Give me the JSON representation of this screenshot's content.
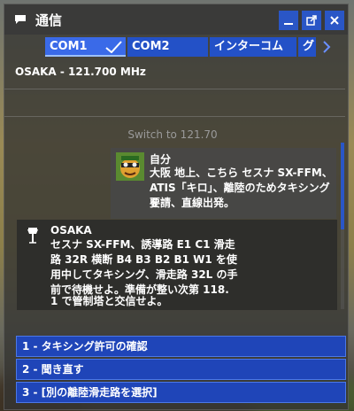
{
  "window": {
    "title": "通信"
  },
  "tabs": [
    {
      "label": "COM1",
      "active": true
    },
    {
      "label": "COM2",
      "active": false
    },
    {
      "label": "インターコム",
      "active": false
    },
    {
      "label": "グ",
      "active": false
    }
  ],
  "frequency": {
    "label": "OSAKA - 121.700 MHz"
  },
  "switch_hint": "Switch to 121.70",
  "messages": {
    "self": {
      "sender": "自分",
      "lines": [
        "大阪 地上、こちら セスナ SX-FFM、",
        "ATIS「キロ」、離陸のためタキシングを",
        "要請、直線出発。"
      ]
    },
    "atc": {
      "sender": "OSAKA",
      "lines": [
        "セスナ SX-FFM、誘導路 E1 C1 滑走",
        "路 32R 横断 B4 B3 B2 B1 W1 を使",
        "用中してタキシング、滑走路 32L の手",
        "前で待機せよ。準備が整い次第 118.",
        "1 で管制塔と交信せよ。"
      ]
    }
  },
  "options": [
    {
      "label": "1 - タキシング許可の確認"
    },
    {
      "label": "2 - 聞き直す"
    },
    {
      "label": "3 - [別の離陸滑走路を選択]"
    }
  ],
  "colors": {
    "accent": "#2351c7",
    "window_bg": "#343432"
  }
}
